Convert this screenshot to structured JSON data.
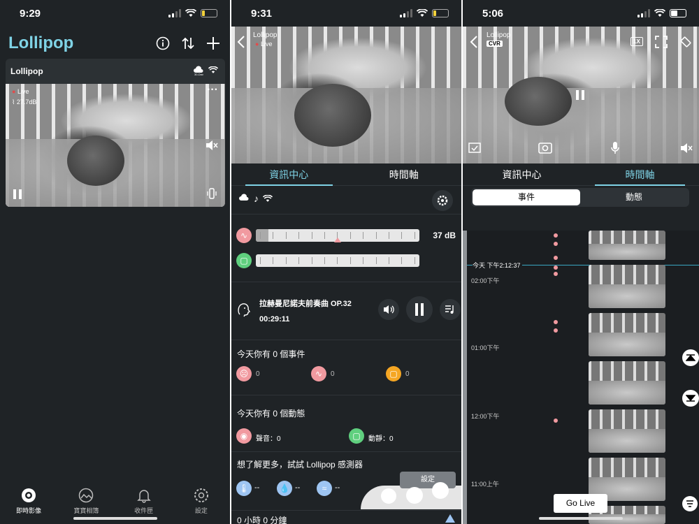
{
  "panel1": {
    "status": {
      "time": "9:29"
    },
    "app_title": "Lollipop",
    "camera_card": {
      "name": "Lollipop",
      "live_label": "Live",
      "db_label": "27.7dB"
    },
    "nav": [
      {
        "label": "即時影像",
        "icon": "camera-icon"
      },
      {
        "label": "寶寶相簿",
        "icon": "album-icon"
      },
      {
        "label": "收件匣",
        "icon": "bell-icon"
      },
      {
        "label": "設定",
        "icon": "gear-icon"
      }
    ]
  },
  "panel2": {
    "status": {
      "time": "9:31"
    },
    "camera_name": "Lollipop",
    "live_label": "Live",
    "tabs": [
      "資訊中心",
      "時間軸"
    ],
    "sound_value": "37 dB",
    "music": {
      "title": "拉赫曼尼諾夫前奏曲 OP.32",
      "time": "00:29:11"
    },
    "events": {
      "heading": "今天你有 0 個事件",
      "counts": [
        "0",
        "0",
        "0"
      ]
    },
    "activity": {
      "heading": "今天你有 0 個動態",
      "sound": "聲音：0",
      "motion": "動靜：0"
    },
    "sensor": {
      "heading": "想了解更多，試試 Lollipop 感測器",
      "values": [
        "--",
        "--",
        "--"
      ],
      "settings_label": "設定"
    },
    "sleep_label": "0 小時 0 分鐘"
  },
  "panel3": {
    "status": {
      "time": "5:06"
    },
    "camera_name": "Lollipop",
    "cvr_badge": "CVR",
    "speed_badge": "1X",
    "tabs": [
      "資訊中心",
      "時間軸"
    ],
    "segments": [
      "事件",
      "動態"
    ],
    "now_label": "今天 下午2:12:37",
    "time_labels": [
      "02:00下午",
      "01:00下午",
      "12:00下午",
      "11:00上午"
    ],
    "go_live_label": "Go Live"
  },
  "colors": {
    "bg": "#1f2326",
    "accent": "#7fd3e6",
    "pink": "#f19aa0",
    "green": "#5fcf7e",
    "orange": "#f5a623",
    "blue": "#9ec5f2"
  }
}
